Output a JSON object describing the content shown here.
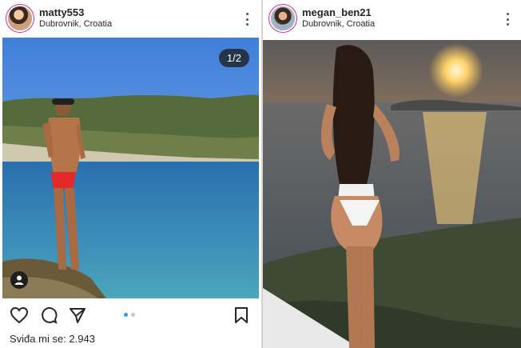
{
  "left_post": {
    "username": "matty553",
    "location": "Dubrovnik, Croatia",
    "photo_counter": "1/2",
    "likes_text": "Sviđa mi se: 2.943",
    "carousel": {
      "total": 2,
      "active": 1
    }
  },
  "right_post": {
    "username": "megan_ben21",
    "location": "Dubrovnik, Croatia"
  },
  "icons": {
    "more": "more-vertical-icon",
    "like": "heart-icon",
    "comment": "comment-icon",
    "share": "send-icon",
    "save": "bookmark-icon",
    "tag": "user-tag-icon"
  },
  "colors": {
    "story_ring": "#d6249f",
    "carousel_active": "#3897f0",
    "text": "#262626"
  }
}
